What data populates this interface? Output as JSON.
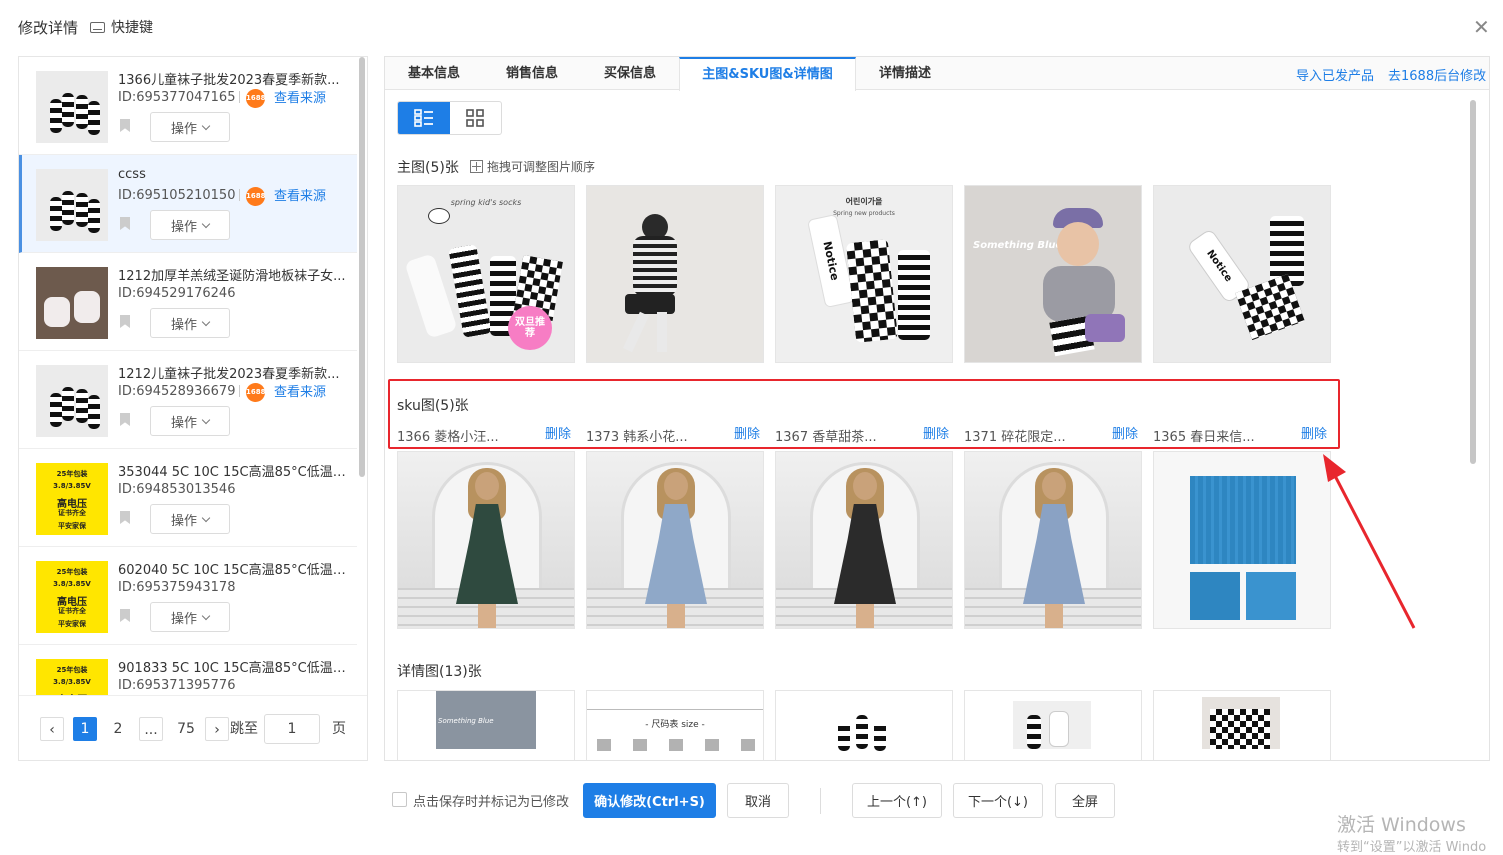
{
  "header": {
    "title": "修改详情",
    "shortcut_label": "快捷键"
  },
  "products": [
    {
      "title": "1366儿童袜子批发2023春夏季新款...",
      "id": "ID:695377047165",
      "badge": "1688",
      "source_link": "查看来源",
      "op_label": "操作",
      "thumb": "socks"
    },
    {
      "title": "ccss",
      "id": "ID:695105210150",
      "badge": "1688",
      "source_link": "查看来源",
      "op_label": "操作",
      "thumb": "socks",
      "active": true
    },
    {
      "title": "1212加厚羊羔绒圣诞防滑地板袜子女...",
      "id": "ID:694529176246",
      "op_label": "操作",
      "thumb": "feet"
    },
    {
      "title": "1212儿童袜子批发2023春夏季新款...",
      "id": "ID:694528936679",
      "badge": "1688",
      "source_link": "查看来源",
      "op_label": "操作",
      "thumb": "socks"
    },
    {
      "title": "353044 5C 10C 15C高温85°C低温4...",
      "id": "ID:694853013546",
      "op_label": "操作",
      "thumb": "battery"
    },
    {
      "title": "602040 5C 10C 15C高温85°C低温4...",
      "id": "ID:695375943178",
      "op_label": "操作",
      "thumb": "battery"
    },
    {
      "title": "901833 5C 10C 15C高温85°C低温4...",
      "id": "ID:695371395776",
      "op_label": "操作",
      "thumb": "battery"
    }
  ],
  "battery_thumb_text": [
    "25年包装",
    "3.8/3.85V",
    "高电压",
    "证书齐全",
    "平安家保"
  ],
  "pagination": {
    "pages": [
      "1",
      "2",
      "...",
      "75"
    ],
    "current": "1",
    "goto_label": "跳至",
    "goto_value": "1",
    "page_suffix": "页"
  },
  "tabs": [
    {
      "label": "基本信息"
    },
    {
      "label": "销售信息"
    },
    {
      "label": "买保信息"
    },
    {
      "label": "主图&SKU图&详情图",
      "active": true
    },
    {
      "label": "详情描述"
    }
  ],
  "tab_links": {
    "import": "导入已发产品",
    "goto_1688": "去1688后台修改"
  },
  "main_images": {
    "title": "主图(5)张",
    "hint": "拖拽可调整图片顺序"
  },
  "sku_images": {
    "title": "sku图(5)张",
    "delete_label": "删除",
    "items": [
      {
        "label": "1366 菱格小汪...",
        "dress_color": "#2f4a3f"
      },
      {
        "label": "1373 韩系小花...",
        "dress_color": "#8fa8c8"
      },
      {
        "label": "1367 香草甜茶...",
        "dress_color": "#2b2b2b"
      },
      {
        "label": "1371 碎花限定...",
        "dress_color": "#8aa2c4"
      },
      {
        "label": "1365 春日来信...",
        "dress_color": "#2e86c1"
      }
    ]
  },
  "detail_images": {
    "title": "详情图(13)张"
  },
  "image_text": {
    "main1_top": "spring kid's socks",
    "main1_badge": "双旦推荐",
    "main3_top": "어린이가을",
    "main3_sub": "Spring new products",
    "main3_sock": "Notice",
    "main4_text": "Something Blue",
    "main5_text": "Notice",
    "detail2_text": "- 尺码表 size -"
  },
  "footer": {
    "checkbox_label": "点击保存时并标记为已修改",
    "confirm": "确认修改(Ctrl+S)",
    "cancel": "取消",
    "prev": "上一个(↑)",
    "next": "下一个(↓)",
    "fullscreen": "全屏"
  },
  "watermark": {
    "line1": "激活 Windows",
    "line2": "转到“设置”以激活 Windo"
  },
  "colors": {
    "accent": "#1e7ee6",
    "highlight_box": "#e8262d",
    "badge_1688": "#ff7a1a"
  }
}
